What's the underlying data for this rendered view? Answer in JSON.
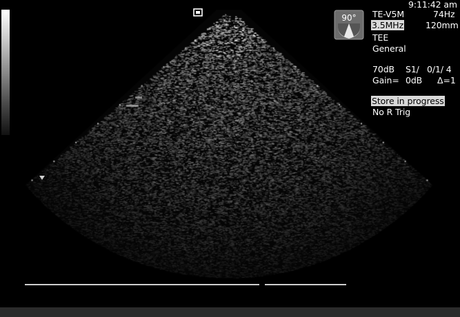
{
  "clock": "9:11:42 am",
  "orientation": {
    "angle": "90°"
  },
  "probe": {
    "name": "TE-V5M",
    "frame_rate": "74Hz",
    "frequency": "3.5MHz",
    "depth": "120mm",
    "mode": "TEE",
    "preset": "General"
  },
  "settings": {
    "line1_a": "70dB",
    "line1_b": "S1/",
    "line1_c": "0/1/ 4",
    "line2_a": "Gain=",
    "line2_b": "0dB",
    "line2_c": "Δ=1"
  },
  "status": {
    "store": "Store in progress",
    "trigger": "No R Trig"
  },
  "colors": {
    "background": "#000000",
    "text": "#ffffff",
    "highlight": "#d9d9d9",
    "bar": "#2b2b2b"
  },
  "icons": [
    "greyscale-bar",
    "orientation-icon",
    "probe-marker-icon",
    "depth-marker-icon"
  ]
}
